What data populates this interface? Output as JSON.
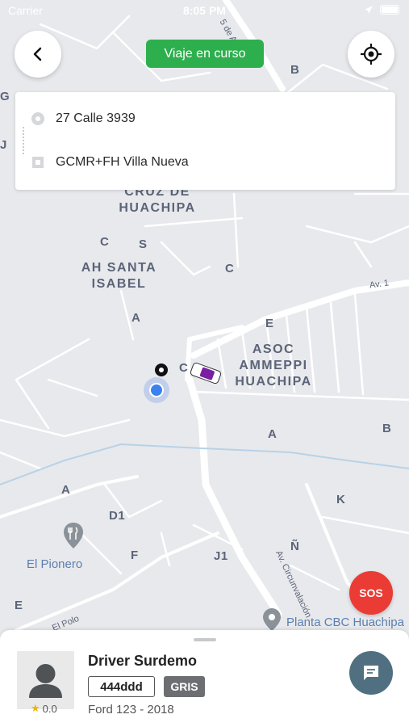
{
  "status_bar": {
    "carrier": "Carrier",
    "time": "8:05 PM"
  },
  "header": {
    "trip_status": "Viaje en curso"
  },
  "route": {
    "origin": "27 Calle 3939",
    "destination": "GCMR+FH Villa Nueva"
  },
  "map": {
    "labels": [
      {
        "text": "CRUZ DE\nHUACHIPA",
        "cls": ""
      },
      {
        "text": "AH SANTA\nISABEL",
        "cls": ""
      },
      {
        "text": "ASOC\nAMMEPPI\nHUACHIPA",
        "cls": ""
      }
    ],
    "letters": [
      "B",
      "G",
      "J",
      "C",
      "S",
      "C",
      "A",
      "E",
      "C",
      "A",
      "B",
      "A",
      "D1",
      "K",
      "F",
      "J1",
      "Ñ",
      "E"
    ],
    "streets": {
      "av1": "Av. 1",
      "circunvalacion": "Av. Circunvalación",
      "el_polo": "El Polo",
      "de_a": "5 de A"
    },
    "pois": {
      "el_pionero": "El Pionero",
      "planta": "Planta CBC Huachipa"
    }
  },
  "sos_label": "SOS",
  "driver": {
    "name": "Driver Surdemo",
    "plate": "444ddd",
    "color": "GRIS",
    "vehicle": "Ford 123 - 2018",
    "rating": "0.0"
  },
  "colors": {
    "accent_green": "#2eaf4e",
    "sos_red": "#ea3b34",
    "chat_blue": "#507082",
    "location_blue": "#3b82f0"
  },
  "icons": {
    "back": "chevron-left-icon",
    "locate": "crosshair-icon",
    "chat": "chat-bubble-icon",
    "star": "star-icon",
    "restaurant": "fork-knife-icon",
    "place": "map-pin-icon"
  }
}
